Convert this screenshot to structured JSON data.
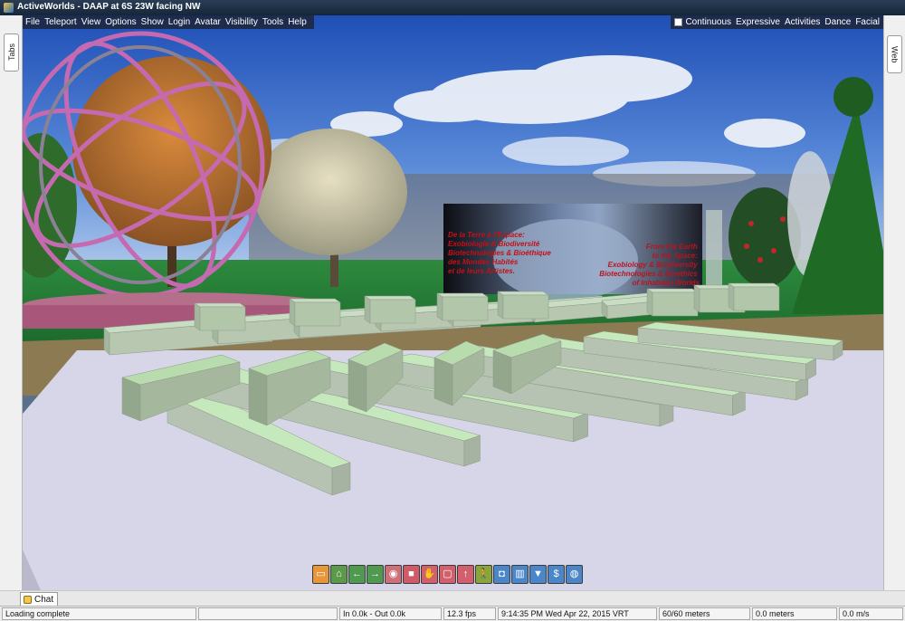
{
  "window": {
    "title": "ActiveWorlds - DAAP at 6S 23W facing NW"
  },
  "side_tabs": {
    "left": "Tabs",
    "right": "Web"
  },
  "menu": {
    "items": [
      "File",
      "Teleport",
      "View",
      "Options",
      "Show",
      "Login",
      "Avatar",
      "Visibility",
      "Tools",
      "Help"
    ]
  },
  "gestures": {
    "items": [
      "Continuous",
      "Expressive",
      "Activities",
      "Dance",
      "Facial"
    ]
  },
  "billboard": {
    "left_lines": [
      "De la Terre à l'Espace:",
      "Exobiologie & Biodiversité",
      "Biotechnologies & Bioéthique",
      "des Mondes Habités",
      "et de leurs Artistes."
    ],
    "right_lines": [
      "From the Earth",
      "to the Space:",
      "Exobiology & Biodiversity",
      "Biotechnologies & Bioethics",
      "of Inhabited Worlds"
    ]
  },
  "toolbar": {
    "buttons": [
      {
        "name": "folder-icon",
        "glyph": "▭",
        "color": "#e8963a"
      },
      {
        "name": "home-icon",
        "glyph": "⌂",
        "color": "#5a9a4a"
      },
      {
        "name": "back-icon",
        "glyph": "←",
        "color": "#4f9a50"
      },
      {
        "name": "forward-icon",
        "glyph": "→",
        "color": "#4f9a50"
      },
      {
        "name": "eye-icon",
        "glyph": "◉",
        "color": "#cf6f7a"
      },
      {
        "name": "camera-icon",
        "glyph": "■",
        "color": "#cf5a68"
      },
      {
        "name": "gesture-icon",
        "glyph": "✋",
        "color": "#d2606c"
      },
      {
        "name": "chat-bubble-icon",
        "glyph": "▢",
        "color": "#d2606c"
      },
      {
        "name": "up-icon",
        "glyph": "↑",
        "color": "#d2606c"
      },
      {
        "name": "walk-icon",
        "glyph": "🚶",
        "color": "#8aa63a"
      },
      {
        "name": "snapshot-icon",
        "glyph": "◘",
        "color": "#4a86c8"
      },
      {
        "name": "map-icon",
        "glyph": "▥",
        "color": "#4a86c8"
      },
      {
        "name": "shirt-icon",
        "glyph": "▼",
        "color": "#4a86c8"
      },
      {
        "name": "money-icon",
        "glyph": "$",
        "color": "#4a86c8"
      },
      {
        "name": "globe-icon",
        "glyph": "◍",
        "color": "#4a86c8"
      }
    ]
  },
  "chat": {
    "tab_label": "Chat"
  },
  "status": {
    "message": "Loading complete",
    "traffic": "In 0.0k - Out 0.0k",
    "fps": "12.3 fps",
    "clock": "9:14:35 PM Wed Apr 22, 2015 VRT",
    "visibility": "60/60 meters",
    "distance": "0.0 meters",
    "speed": "0.0 m/s"
  }
}
